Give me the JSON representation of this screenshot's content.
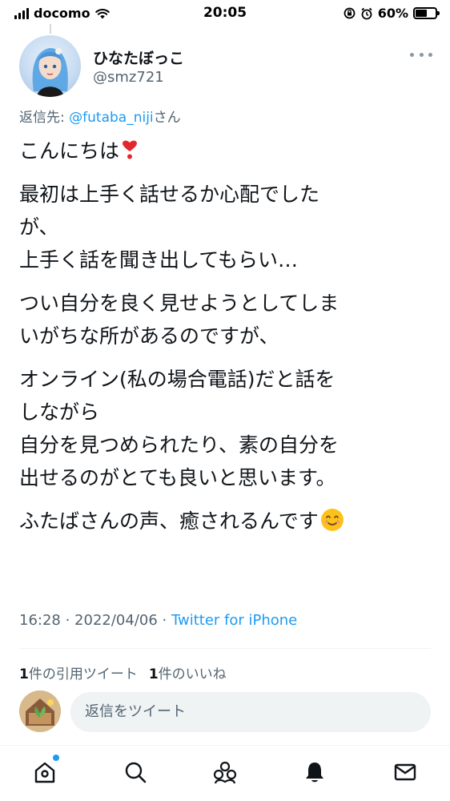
{
  "status_bar": {
    "carrier": "docomo",
    "time": "20:05",
    "battery_percent": "60%",
    "battery_level": 0.6
  },
  "author": {
    "name": "ひなたぼっこ",
    "handle": "@smz721"
  },
  "reply_to": {
    "prefix": "返信先: ",
    "mention": "@futaba_niji",
    "suffix": "さん"
  },
  "tweet": {
    "paragraphs": [
      [
        "こんにちは"
      ],
      [
        "最初は上手く話せるか心配でした",
        "が、",
        "上手く話を聞き出してもらい…"
      ],
      [
        "つい自分を良く見せようとしてしま",
        "いがちな所があるのですが、"
      ],
      [
        "オンライン(私の場合電話)だと話を",
        "しながら",
        "自分を見つめられたり、素の自分を",
        "出せるのがとても良いと思います。"
      ],
      [
        "ふたばさんの声、癒されるんです"
      ]
    ],
    "emojis": {
      "heart": "red-heart-exclamation",
      "smile": "smiling-face"
    }
  },
  "meta": {
    "time": "16:28",
    "separator": " · ",
    "date": "2022/04/06",
    "source": "Twitter for iPhone"
  },
  "stats": {
    "quote_count": "1",
    "quote_label": "件の引用ツイート",
    "like_count": "1",
    "like_label": "件のいいね"
  },
  "reply_bar": {
    "placeholder": "返信をツイート"
  },
  "tab_bar": {
    "items": [
      "home-icon",
      "search-icon",
      "communities-icon",
      "notifications-icon",
      "messages-icon"
    ]
  },
  "colors": {
    "accent": "#1d9bf0",
    "text": "#0f1419",
    "secondary": "#536471"
  }
}
